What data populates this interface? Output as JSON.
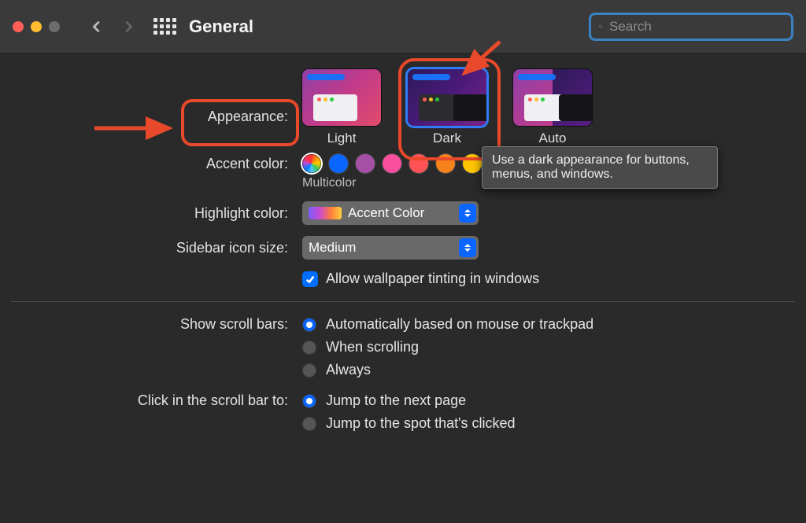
{
  "toolbar": {
    "title": "General",
    "search_placeholder": "Search"
  },
  "appearance": {
    "label": "Appearance:",
    "options": [
      {
        "label": "Light"
      },
      {
        "label": "Dark"
      },
      {
        "label": "Auto"
      }
    ],
    "selected": "Dark",
    "tooltip": "Use a dark appearance for buttons, menus, and windows."
  },
  "accent": {
    "label": "Accent color:",
    "selected_name": "Multicolor",
    "colors": [
      {
        "name": "Multicolor",
        "css": "multi"
      },
      {
        "name": "Blue",
        "hex": "#0a66ff"
      },
      {
        "name": "Purple",
        "hex": "#a550a7"
      },
      {
        "name": "Pink",
        "hex": "#f74f9e"
      },
      {
        "name": "Red",
        "hex": "#ff5257"
      },
      {
        "name": "Orange",
        "hex": "#f7821b"
      },
      {
        "name": "Yellow",
        "hex": "#ffc600"
      }
    ]
  },
  "highlight": {
    "label": "Highlight color:",
    "value": "Accent Color"
  },
  "sidebar_icon": {
    "label": "Sidebar icon size:",
    "value": "Medium"
  },
  "wallpaper_tint": {
    "label": "Allow wallpaper tinting in windows",
    "checked": true
  },
  "scrollbars": {
    "label": "Show scroll bars:",
    "options": [
      "Automatically based on mouse or trackpad",
      "When scrolling",
      "Always"
    ],
    "selected_index": 0
  },
  "click_scroll": {
    "label": "Click in the scroll bar to:",
    "options": [
      "Jump to the next page",
      "Jump to the spot that's clicked"
    ],
    "selected_index": 0
  }
}
